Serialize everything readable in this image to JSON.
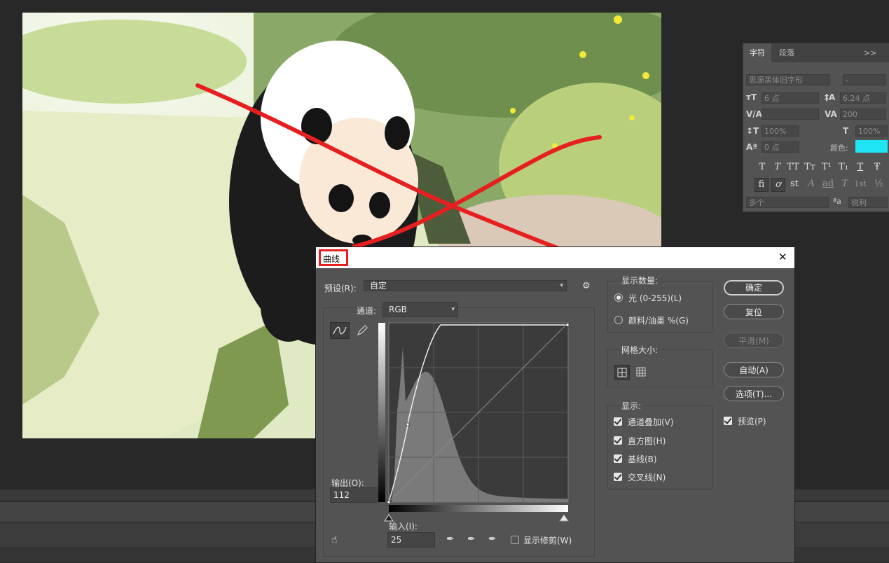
{
  "colors": {
    "accent_cyan": "#1ee6f5",
    "highlight_red": "#e62020"
  },
  "char_panel": {
    "tab_character": "字符",
    "tab_paragraph": "段落",
    "menu_glyph": ">>",
    "font_family": "思源黑体旧字形",
    "font_style": "-",
    "font_size": "6 点",
    "leading": "6.24 点",
    "kerning": "",
    "tracking": "200",
    "vertical_scale": "100%",
    "horizontal_scale": "100%",
    "baseline_shift": "0 点",
    "color_label": "颜色:",
    "style_glyphs": [
      "T",
      "T",
      "TT",
      "Tт",
      "T¹",
      "T₁",
      "T",
      "Ŧ"
    ],
    "opentype_glyphs": [
      "fi",
      "ơ",
      "st",
      "A",
      "ad",
      "T",
      "1st",
      "½"
    ],
    "language": "多个",
    "aa_icon": "ªa",
    "antialias": "锐利"
  },
  "curves_dialog": {
    "title": "曲线",
    "close": "✕",
    "preset_label": "预设(R):",
    "preset_value": "自定",
    "channel_label": "通道:",
    "channel_value": "RGB",
    "output_label": "输出(O):",
    "output_value": "112",
    "input_label": "输入(I):",
    "input_value": "25",
    "show_clipping": "显示修剪(W)",
    "display_amount": {
      "label": "显示数量:",
      "light": "光 (0-255)(L)",
      "pigment": "颜料/油墨 %(G)"
    },
    "grid_size_label": "网格大小:",
    "show_label": "显示:",
    "show_options": [
      {
        "label": "通道叠加(V)",
        "checked": true
      },
      {
        "label": "直方图(H)",
        "checked": true
      },
      {
        "label": "基线(B)",
        "checked": true
      },
      {
        "label": "交叉线(N)",
        "checked": true
      }
    ],
    "buttons": {
      "ok": "确定",
      "reset": "复位",
      "smooth": "平滑(M)",
      "auto": "自动(A)",
      "options": "选项(T)..."
    },
    "preview_label": "预览(P)",
    "preview_checked": true
  }
}
